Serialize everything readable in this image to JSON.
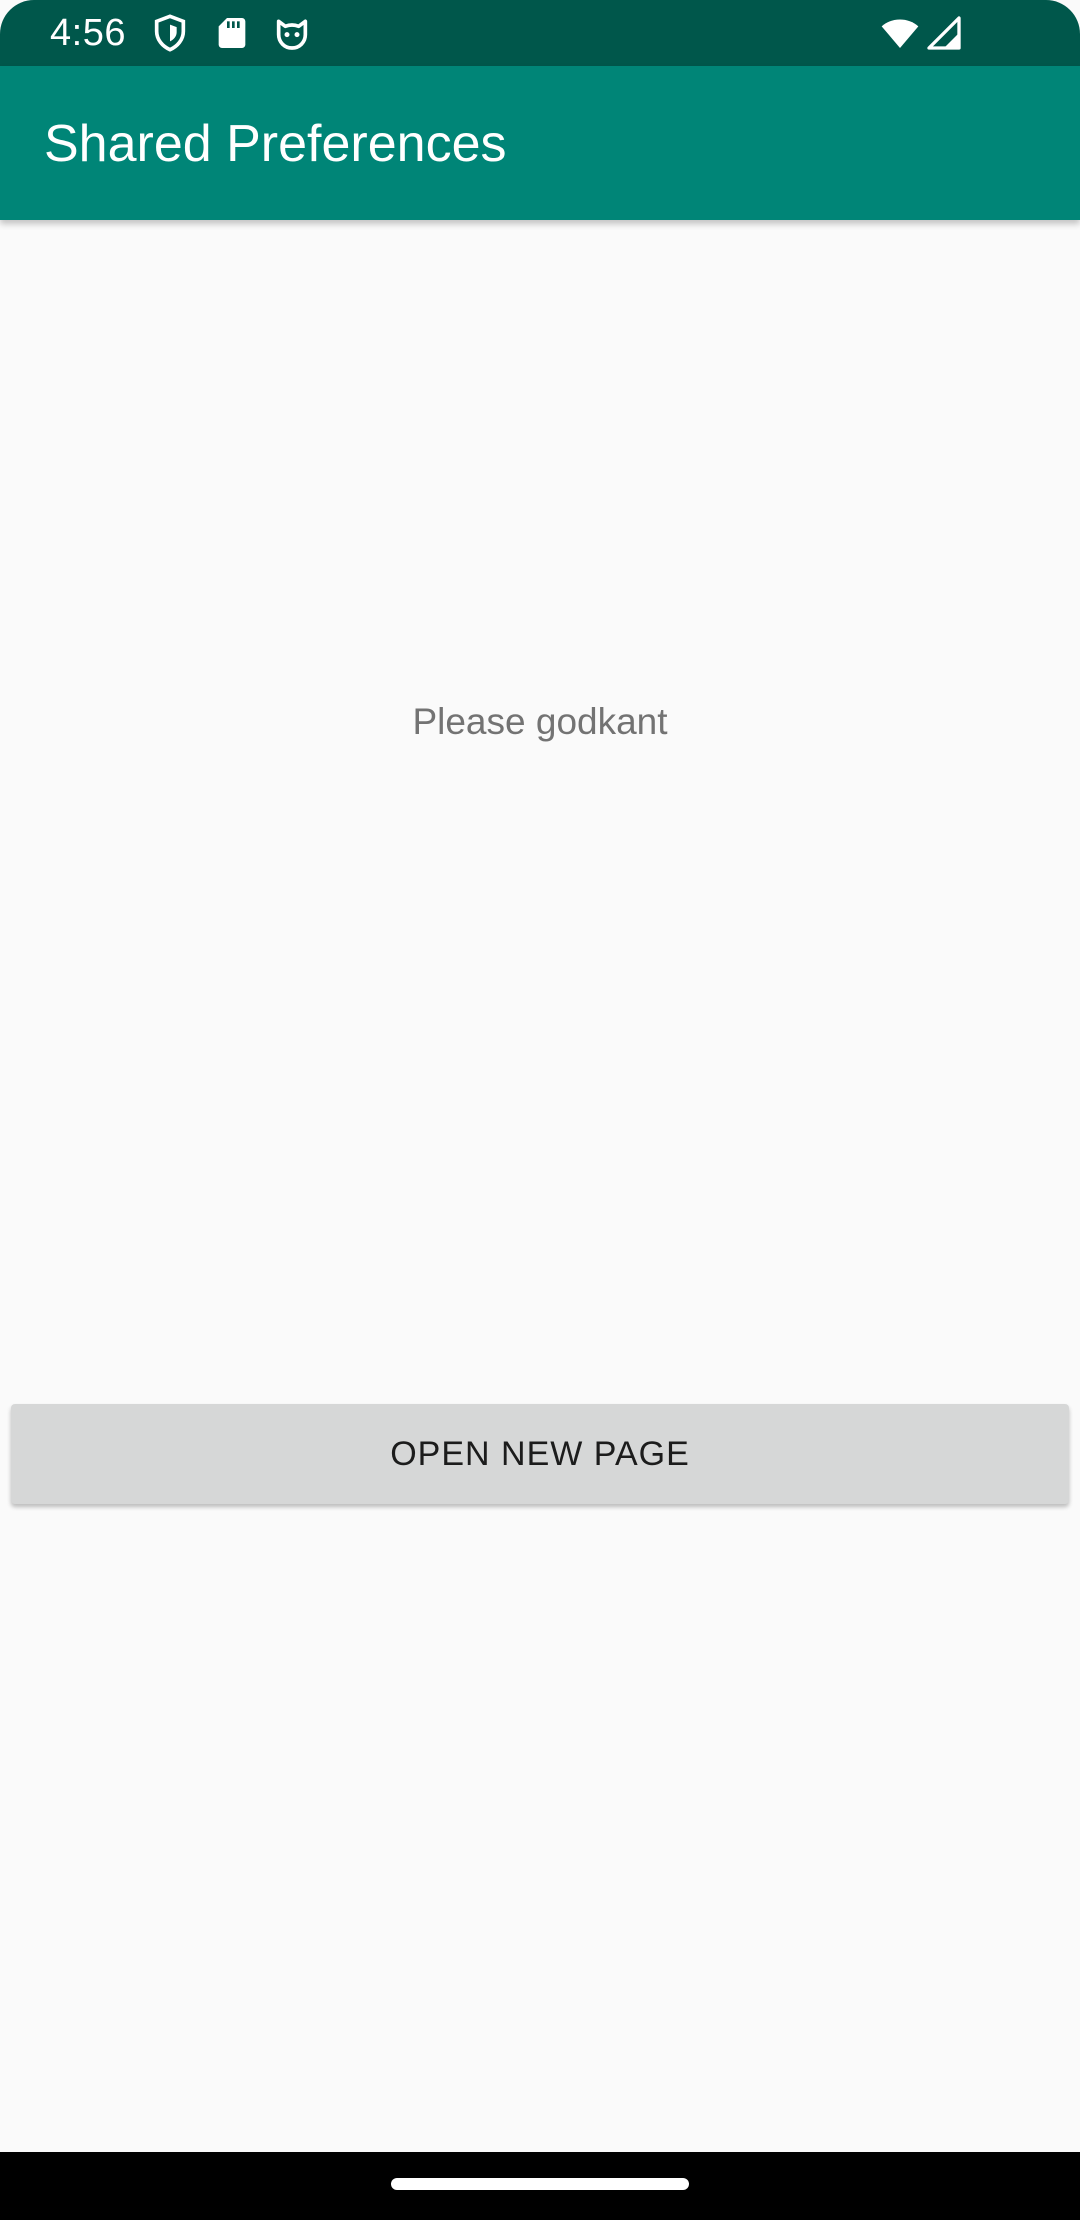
{
  "status_bar": {
    "time": "4:56",
    "icons": [
      "shield-icon",
      "sd-card-icon",
      "cat-face-icon",
      "wifi-icon",
      "signal-icon"
    ]
  },
  "app_bar": {
    "title": "Shared Preferences"
  },
  "content": {
    "message": "Please godkant",
    "button_label": "OPEN NEW PAGE"
  },
  "colors": {
    "status_bar": "#00574b",
    "app_bar": "#008577",
    "background": "#fafafa",
    "button": "#d6d7d7"
  }
}
